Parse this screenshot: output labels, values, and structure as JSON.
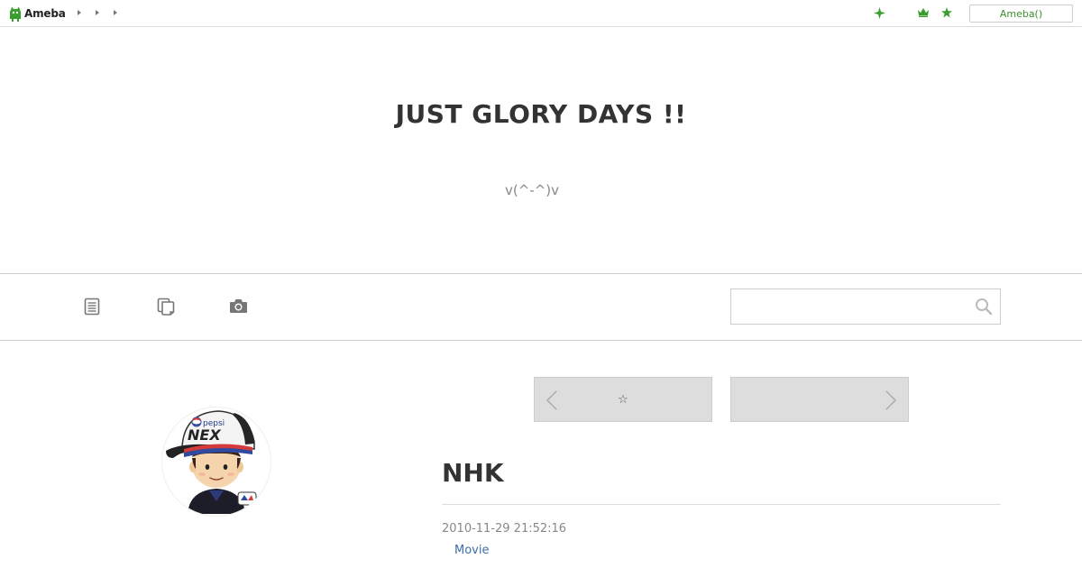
{
  "topbar": {
    "logo_text": "Ameba",
    "login_label": "Ameba()",
    "icons": [
      "sparkle-icon",
      "crown-icon",
      "star-icon"
    ],
    "accent_color": "#3a9e2f"
  },
  "header": {
    "title": "JUST GLORY DAYS !!",
    "description": "v(^-^)v"
  },
  "nav": {
    "icons": [
      "entry-list-icon",
      "archive-icon",
      "camera-icon"
    ],
    "search": {
      "placeholder": "",
      "value": ""
    }
  },
  "pager": {
    "prev_label": "☆",
    "next_label": ""
  },
  "article": {
    "title": "NHK",
    "date": "2010-11-29 21:52:16",
    "theme": "Movie"
  },
  "avatar": {
    "cap_brand": "pepsi",
    "cap_text": "NEX"
  }
}
